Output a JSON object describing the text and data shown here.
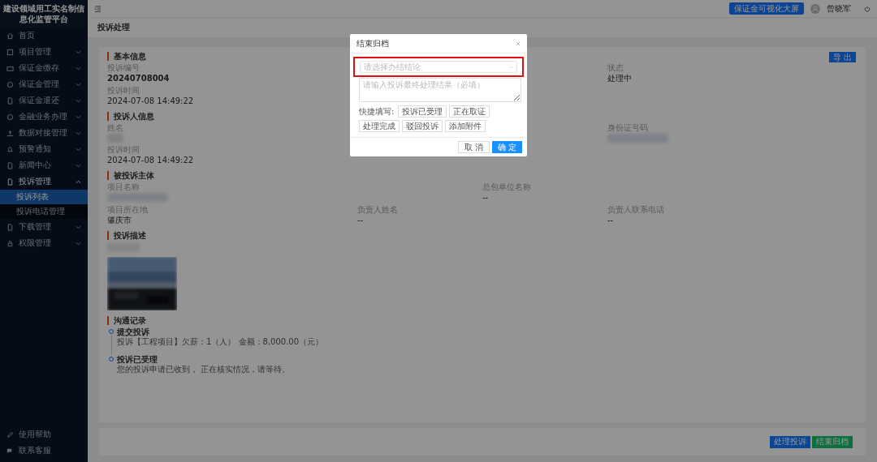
{
  "app_title": "建设领域用工实名制信息化监管平台",
  "sidebar": {
    "items": [
      {
        "label": "首页",
        "selected": false
      },
      {
        "label": "项目管理",
        "selected": false,
        "expanded": false
      },
      {
        "label": "保证金缴存",
        "selected": false,
        "expanded": false
      },
      {
        "label": "保证金管理",
        "selected": false,
        "expanded": false
      },
      {
        "label": "保证金退还",
        "selected": false,
        "expanded": false
      },
      {
        "label": "金融业务办理",
        "selected": false,
        "expanded": false
      },
      {
        "label": "数据对接管理",
        "selected": false,
        "expanded": false
      },
      {
        "label": "预警通知",
        "selected": false,
        "expanded": false
      },
      {
        "label": "新闻中心",
        "selected": false,
        "expanded": false
      },
      {
        "label": "投诉管理",
        "selected": false,
        "expanded": true,
        "children": [
          {
            "label": "投诉列表",
            "selected": true
          },
          {
            "label": "投诉电话管理",
            "selected": false
          }
        ]
      },
      {
        "label": "下载管理",
        "selected": false,
        "expanded": false
      },
      {
        "label": "权限管理",
        "selected": false,
        "expanded": false
      }
    ],
    "footer": [
      "使用帮助",
      "联系客服"
    ]
  },
  "topbar": {
    "screen_button": "保证金可视化大屏",
    "user": "曾晓军"
  },
  "page_title": "投诉处理",
  "export_button": "导 出",
  "sections": [
    {
      "title": "基本信息",
      "fields": [
        {
          "label": "投诉编号",
          "value": "20240708004",
          "bold": true
        },
        {
          "label": "状态",
          "value": "处理中",
          "bold": false
        },
        {
          "label": "投诉时间",
          "value": "2024-07-08 14:49:22",
          "bold": false
        }
      ]
    },
    {
      "title": "投诉人信息",
      "fields": [
        {
          "label": "姓名",
          "blurred": true
        },
        {
          "label": "身份证号码",
          "blurred": true
        },
        {
          "label": "投诉时间",
          "value": "2024-07-08 14:49:22",
          "bold": false
        }
      ]
    },
    {
      "title": "被投诉主体",
      "fields": [
        {
          "label": "项目名称",
          "blurred": true
        },
        {
          "label": "总包单位名称",
          "value": "--",
          "bold": false
        },
        {
          "label": "项目所在地",
          "value": "肇庆市",
          "bold": false
        },
        {
          "label": "负责人姓名",
          "value": "--",
          "bold": false
        },
        {
          "label": "负责人联系电话",
          "value": "--",
          "bold": false
        }
      ]
    }
  ],
  "description": {
    "title": "投诉描述"
  },
  "timeline": {
    "title": "沟通记录",
    "events": [
      {
        "title": "提交投诉",
        "text": "投诉【工程项目】欠薪：1（人） 金额：8,000.00（元）"
      },
      {
        "title": "投诉已受理",
        "text": "您的投诉申请已收到， 正在核实情况，请等待。"
      }
    ]
  },
  "footer_buttons": [
    {
      "label": "处理投诉",
      "kind": "primary"
    },
    {
      "label": "结束归档",
      "kind": "success"
    }
  ],
  "dialog": {
    "title": "结束归档",
    "select": {
      "placeholder": "请选择办结结论",
      "highlighted": true
    },
    "textarea": {
      "placeholder": "请输入投诉最终处理结果（必填）"
    },
    "quick_label": "快捷填写:",
    "quick_buttons": [
      "投诉已受理",
      "正在取证",
      "处理完成",
      "驳回投诉",
      "添加附件"
    ],
    "cancel": "取 消",
    "confirm": "确 定"
  }
}
